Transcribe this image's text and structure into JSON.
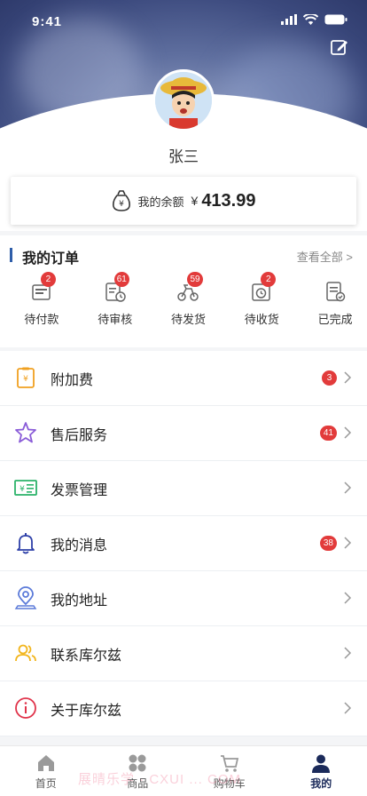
{
  "status_bar": {
    "time": "9:41"
  },
  "profile": {
    "name": "张三"
  },
  "balance": {
    "label": "我的余额",
    "currency": "¥",
    "amount": "413.99"
  },
  "orders": {
    "title": "我的订单",
    "view_all": "查看全部 >",
    "items": [
      {
        "label": "待付款",
        "badge": "2",
        "icon": "wallet-icon"
      },
      {
        "label": "待审核",
        "badge": "61",
        "icon": "clipboard-clock-icon"
      },
      {
        "label": "待发货",
        "badge": "59",
        "icon": "bike-icon"
      },
      {
        "label": "待收货",
        "badge": "2",
        "icon": "box-clock-icon"
      },
      {
        "label": "已完成",
        "badge": "",
        "icon": "list-check-icon"
      }
    ]
  },
  "menu": [
    {
      "label": "附加费",
      "badge": "3",
      "icon": "receipt-icon",
      "color": "#f0a020"
    },
    {
      "label": "售后服务",
      "badge": "41",
      "icon": "star-icon",
      "color": "#8a5cd8"
    },
    {
      "label": "发票管理",
      "badge": "",
      "icon": "invoice-icon",
      "color": "#2bb36a"
    },
    {
      "label": "我的消息",
      "badge": "38",
      "icon": "bell-icon",
      "color": "#2d3fa8"
    },
    {
      "label": "我的地址",
      "badge": "",
      "icon": "location-icon",
      "color": "#5b7ad9"
    },
    {
      "label": "联系库尔兹",
      "badge": "",
      "icon": "contacts-icon",
      "color": "#f2b51c"
    },
    {
      "label": "关于库尔兹",
      "badge": "",
      "icon": "info-icon",
      "color": "#e0334a"
    }
  ],
  "tabs": [
    {
      "label": "首页",
      "icon": "home-icon",
      "active": false
    },
    {
      "label": "商品",
      "icon": "grid-icon",
      "active": false
    },
    {
      "label": "购物车",
      "icon": "cart-icon",
      "active": false
    },
    {
      "label": "我的",
      "icon": "user-icon",
      "active": true
    }
  ],
  "watermark": "展晴乐学 · CXUI ... COM",
  "colors": {
    "badge": "#e23b3b",
    "accent": "#2f5ea9",
    "active_tab": "#1b2a5a"
  }
}
